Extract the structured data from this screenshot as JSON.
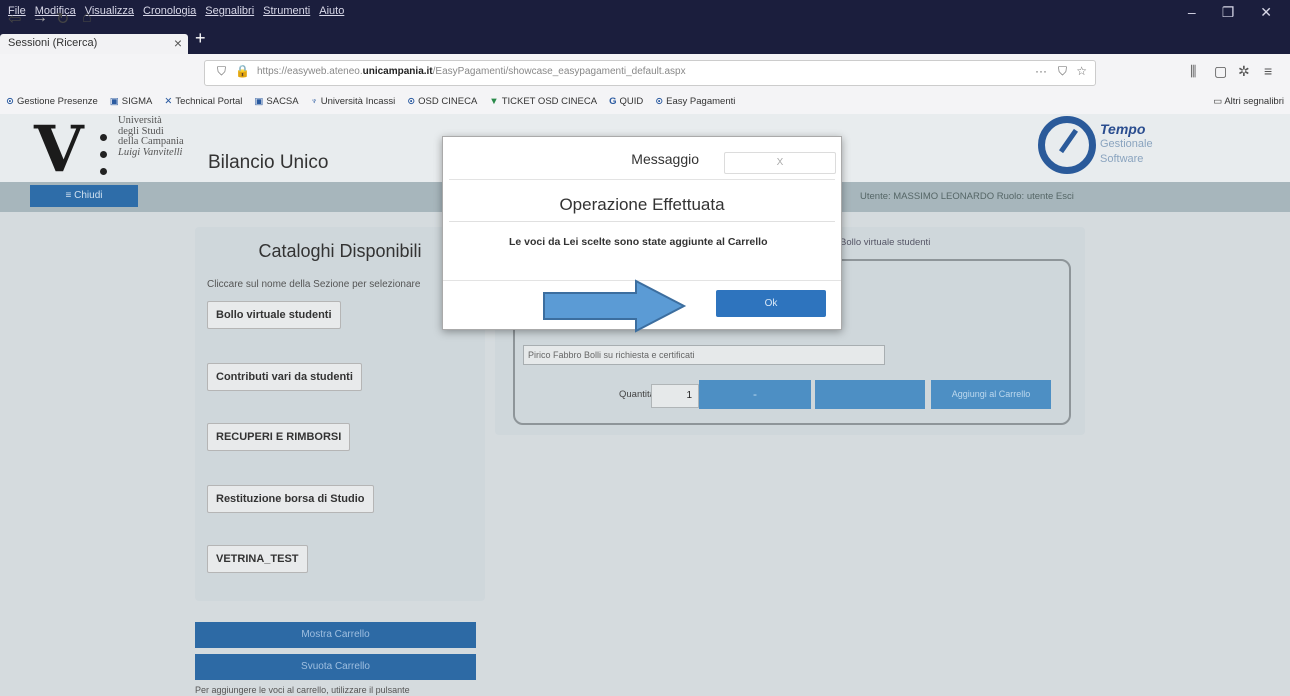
{
  "browser": {
    "menu": [
      "File",
      "Modifica",
      "Visualizza",
      "Cronologia",
      "Segnalibri",
      "Strumenti",
      "Aiuto"
    ],
    "window_controls": [
      "–",
      "❐",
      "✕"
    ],
    "tab_title": "Sessioni (Ricerca)",
    "url_prefix": "https://easyweb.ateneo.",
    "url_domain": "unicampania.it",
    "url_suffix": "/EasyPagamenti/showcase_easypagamenti_default.aspx",
    "bookmarks": [
      "Gestione Presenze",
      "SIGMA",
      "Technical Portal",
      "SACSA",
      "Università Incassi",
      "OSD CINECA",
      "TICKET OSD CINECA",
      "QUID",
      "Easy Pagamenti"
    ],
    "other_bookmarks": "Altri segnalibri"
  },
  "header": {
    "university_lines": [
      "Università",
      "degli Studi",
      "della Campania",
      "Luigi Vanvitelli"
    ],
    "app_title": "Bilancio Unico",
    "brand_line1": "Tempo",
    "brand_line2": "Gestionale",
    "brand_line3": "Software",
    "close_menu_label": "≡ Chiudi",
    "user_info": "Utente: MASSIMO LEONARDO    Ruolo: utente    Esci"
  },
  "catalog": {
    "title": "Cataloghi Disponibili",
    "hint": "Cliccare sul nome della Sezione per selezionare",
    "items": [
      "Bollo virtuale studenti",
      "Contributi vari da studenti",
      "RECUPERI E RIMBORSI",
      "Restituzione borsa di Studio",
      "VETRINA_TEST"
    ],
    "show_cart": "Mostra Carrello",
    "empty_cart": "Svuota Carrello",
    "footer_note": "Per aggiungere le voci al carrello, utilizzare il pulsante"
  },
  "detail": {
    "title": "Bollo virtuale studenti",
    "product": "Pirico Fabbro Bolli su richiesta e certificati",
    "qty_label": "Quantità",
    "qty_value": "1",
    "btn_minus": "-",
    "add_to_cart": "Aggiungi al Carrello"
  },
  "modal": {
    "title": "Messaggio",
    "close_label": "X",
    "heading": "Operazione Effettuata",
    "message": "Le voci da Lei scelte sono state aggiunte al Carrello",
    "ok_label": "Ok"
  },
  "colors": {
    "menubar": "#1b1e3d",
    "primary_blue": "#2e74be",
    "arrow_fill": "#5b9bd5"
  }
}
